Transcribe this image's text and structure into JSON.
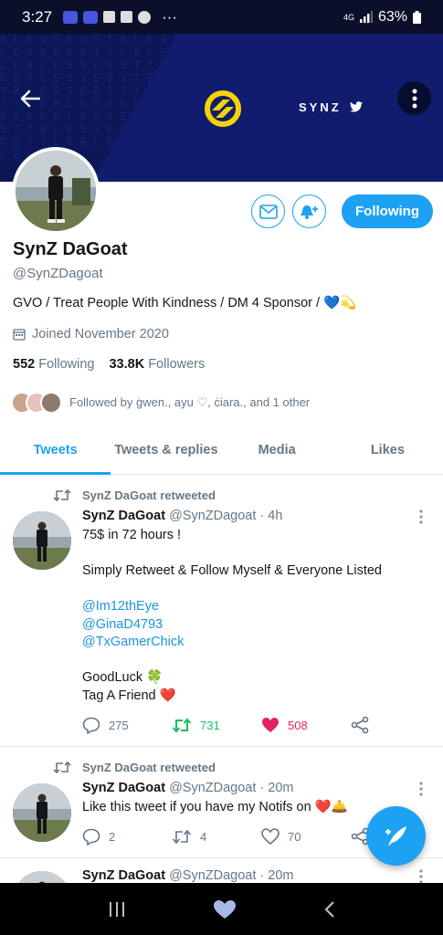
{
  "status_bar": {
    "time": "3:27",
    "network": "4G",
    "battery": "63%"
  },
  "banner": {
    "brand_name": "SYNZ",
    "background_text": "BLESSEDSTBLESSEDSTYBLESSEDSTYLBLESSEDSTYLEBLESSEDSTYLESBLESSEDBLESSEDSTBLESSEDSTYBLESSEDSTYLBLESSEDSTYLEBLESSEDSTYLESBLESSEDBLESSEDSTBLESSEDSTYBLESSEDSTYLBLESSEDSTYLEBLESSEDSTYLESBLESSED"
  },
  "profile": {
    "name": "SynZ DaGoat",
    "handle": "@SynZDagoat",
    "bio": "GVO / Treat People With Kindness / DM 4 Sponsor / 💙💫",
    "joined": "Joined November 2020",
    "following_count": "552",
    "following_label": "Following",
    "followers_count": "33.8K",
    "followers_label": "Followers",
    "followed_by": "Followed by ġwen., ayu ♡, ċiara., and 1 other",
    "follow_button": "Following"
  },
  "tabs": [
    {
      "label": "Tweets",
      "active": true
    },
    {
      "label": "Tweets & replies",
      "active": false
    },
    {
      "label": "Media",
      "active": false
    },
    {
      "label": "Likes",
      "active": false
    }
  ],
  "tweets": [
    {
      "retweeted_by": "SynZ DaGoat retweeted",
      "name": "SynZ DaGoat",
      "handle": "@SynZDagoat",
      "time": "· 4h",
      "lines": [
        "75$ in 72 hours !",
        "",
        "Simply Retweet & Follow Myself & Everyone Listed",
        ""
      ],
      "links": [
        "@Im12thEye",
        "@GinaD4793",
        "@TxGamerChick"
      ],
      "footer_lines": [
        "GoodLuck 🍀",
        "Tag A Friend ❤️"
      ],
      "replies": "275",
      "retweets": "731",
      "likes": "508",
      "retweeted": true,
      "liked": true
    },
    {
      "retweeted_by": "SynZ DaGoat retweeted",
      "name": "SynZ DaGoat",
      "handle": "@SynZDagoat",
      "time": "· 20m",
      "text": "Like this tweet if you have my Notifs on ❤️🛎️",
      "replies": "2",
      "retweets": "4",
      "likes": "70",
      "retweeted": false,
      "liked": false
    },
    {
      "name": "SynZ DaGoat",
      "handle": "@SynZDagoat",
      "time": "· 20m"
    }
  ],
  "colors": {
    "accent": "#1da1f2",
    "retweet": "#17bf63",
    "like": "#e0245e",
    "banner": "#0b1757"
  }
}
